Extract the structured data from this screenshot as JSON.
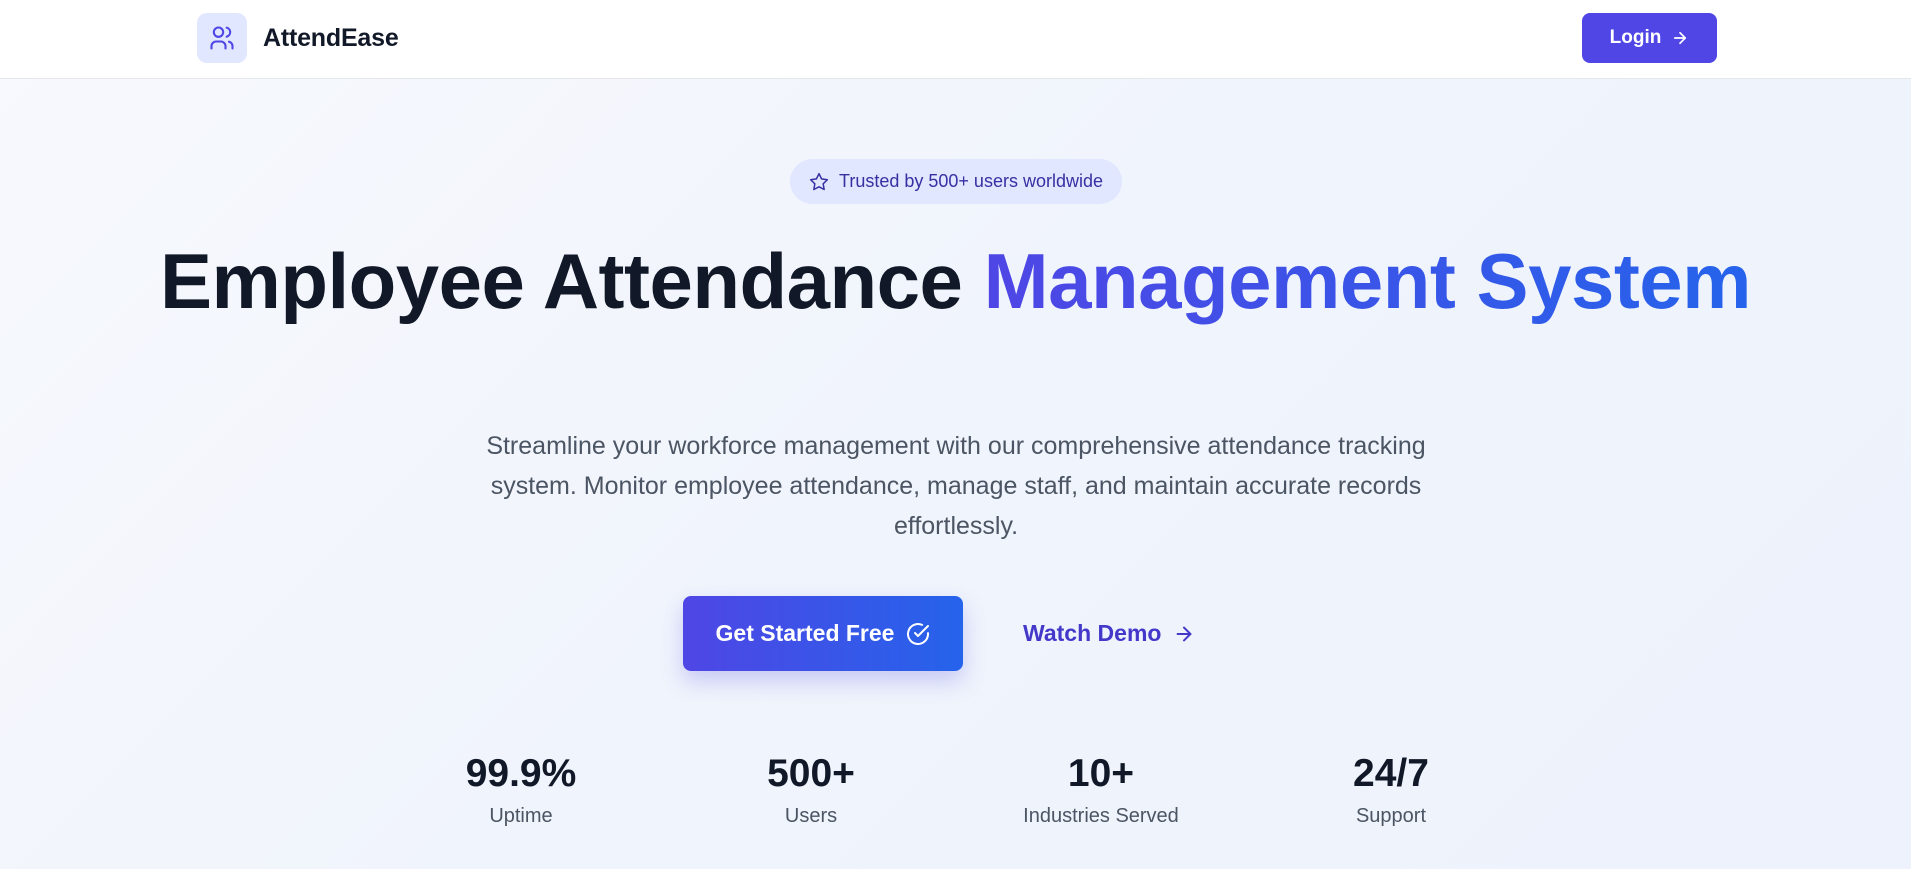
{
  "header": {
    "brand_name": "AttendEase",
    "brand_icon": "users-icon",
    "login_label": "Login",
    "login_icon": "arrow-right-icon"
  },
  "hero": {
    "badge_text": "Trusted by 500+ users worldwide",
    "badge_icon": "star-icon",
    "title_part1": "Employee Attendance ",
    "title_accent": "Management System",
    "subtitle": "Streamline your workforce management with our comprehensive attendance tracking system. Monitor employee attendance, manage staff, and maintain accurate records effortlessly.",
    "cta_primary_label": "Get Started Free",
    "cta_primary_icon": "check-circle-icon",
    "cta_secondary_label": "Watch Demo",
    "cta_secondary_icon": "arrow-right-icon"
  },
  "stats": [
    {
      "value": "99.9%",
      "label": "Uptime"
    },
    {
      "value": "500+",
      "label": "Users"
    },
    {
      "value": "10+",
      "label": "Industries Served"
    },
    {
      "value": "24/7",
      "label": "Support"
    }
  ],
  "colors": {
    "primary": "#4f46e5",
    "primary_end": "#2563eb",
    "text_dark": "#111827",
    "text_muted": "#4b5563",
    "badge_bg": "#e0e7ff",
    "badge_text": "#3730a3"
  }
}
